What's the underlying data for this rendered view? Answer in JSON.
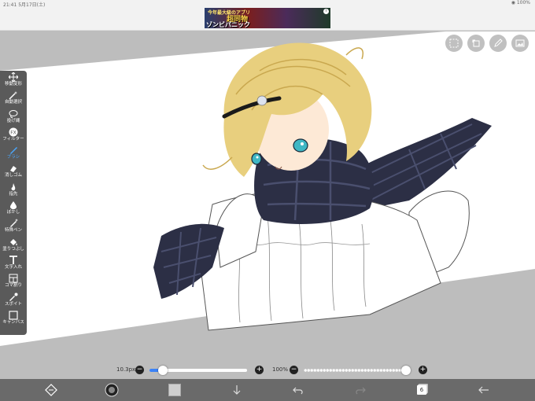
{
  "status_bar": {
    "left": "21:41 5月17日(土)",
    "right": "◉ 100%"
  },
  "ad": {
    "top": "今年最大級のアプリ",
    "main": "超同物",
    "sub": "ゾンビパニック",
    "info": "i"
  },
  "top_tools": [
    "selection-icon",
    "transform-icon",
    "pen-icon",
    "gallery-icon"
  ],
  "tools": [
    {
      "id": "move",
      "label": "移動変形",
      "icon": "move-icon"
    },
    {
      "id": "magic",
      "label": "自動選択",
      "icon": "magic-wand-icon"
    },
    {
      "id": "lasso",
      "label": "投げ縄",
      "icon": "lasso-icon"
    },
    {
      "id": "filter",
      "label": "フィルター",
      "icon": "fx-icon"
    },
    {
      "id": "brush",
      "label": "ブラシ",
      "icon": "brush-icon",
      "active": true
    },
    {
      "id": "eraser",
      "label": "消しゴム",
      "icon": "eraser-icon"
    },
    {
      "id": "finger",
      "label": "指先",
      "icon": "finger-icon"
    },
    {
      "id": "blur",
      "label": "ぼかし",
      "icon": "blur-icon"
    },
    {
      "id": "special",
      "label": "特殊ペン",
      "icon": "special-pen-icon"
    },
    {
      "id": "fill",
      "label": "塗りつぶし",
      "icon": "bucket-icon"
    },
    {
      "id": "text",
      "label": "文字入れ",
      "icon": "text-icon"
    },
    {
      "id": "frame",
      "label": "コマ割り",
      "icon": "frame-icon"
    },
    {
      "id": "dropper",
      "label": "スポイト",
      "icon": "dropper-icon"
    },
    {
      "id": "canvas",
      "label": "キャンバス",
      "icon": "canvas-icon"
    }
  ],
  "brush_size": {
    "label": "10.3px",
    "level": 0.1
  },
  "opacity": {
    "label": "100%",
    "level": 1.0
  },
  "bottom_bar": {
    "layer_count": "6"
  },
  "colors": {
    "panel": "#5a5a5a",
    "accent": "#3b82f6",
    "hair": "#e8cf7e",
    "scarf": "#2c2f45"
  }
}
